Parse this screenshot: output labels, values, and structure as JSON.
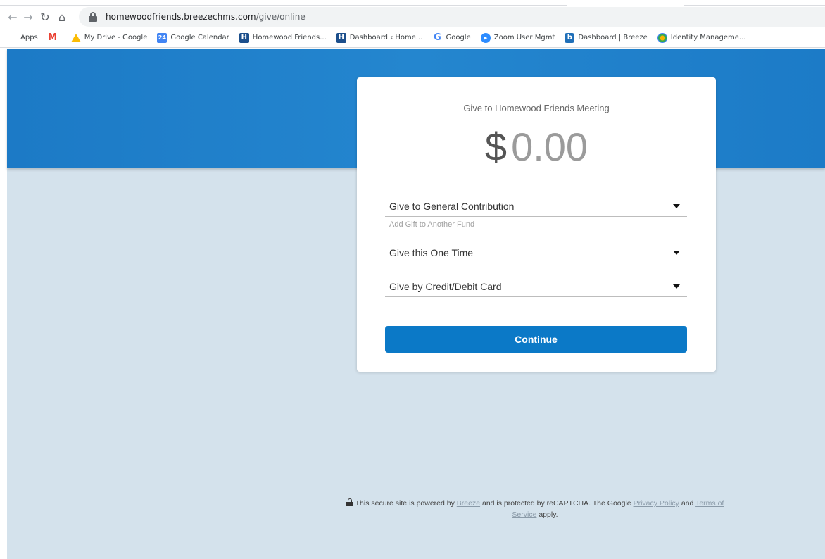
{
  "browser": {
    "url_host": "homewoodfriends.breezechms.com",
    "url_path": "/give/online",
    "bookmarks": [
      {
        "label": "Apps",
        "icon": "apps-grid-icon"
      },
      {
        "label": "",
        "icon": "gmail-icon"
      },
      {
        "label": "My Drive - Google",
        "icon": "google-drive-icon"
      },
      {
        "label": "Google Calendar",
        "icon": "google-calendar-icon",
        "badge": "24"
      },
      {
        "label": "Homewood Friends...",
        "icon": "homewood-h-icon",
        "badge": "H"
      },
      {
        "label": "Dashboard ‹ Home...",
        "icon": "homewood-h-icon",
        "badge": "H"
      },
      {
        "label": "Google",
        "icon": "google-g-icon",
        "badge": "G"
      },
      {
        "label": "Zoom User Mgmt",
        "icon": "zoom-icon",
        "badge": "▶"
      },
      {
        "label": "Dashboard | Breeze",
        "icon": "breeze-b-icon",
        "badge": "b"
      },
      {
        "label": "Identity Manageme...",
        "icon": "identity-icon"
      }
    ]
  },
  "giving": {
    "title": "Give to Homewood Friends Meeting",
    "currency": "$",
    "amount": "0.00",
    "fund_select": "Give to General Contribution",
    "add_fund_link": "Add Gift to Another Fund",
    "frequency_select": "Give this One Time",
    "method_select": "Give by Credit/Debit Card",
    "continue_label": "Continue"
  },
  "footer": {
    "text_1": "This secure site is powered by ",
    "link_breeze": "Breeze",
    "text_2": " and is protected by reCAPTCHA. The Google ",
    "link_privacy": "Privacy Policy",
    "text_3": " and ",
    "link_terms": "Terms of Service",
    "text_4": " apply."
  },
  "colors": {
    "banner": "#1c7ac6",
    "page_bg": "#d4e2ec",
    "button": "#0b79c7"
  }
}
